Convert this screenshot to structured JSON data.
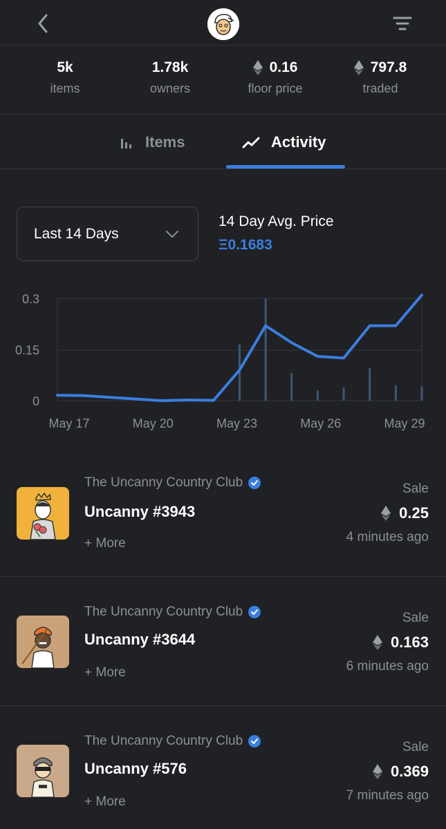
{
  "header": {
    "back_icon": "chevron-left-icon",
    "avatar_icon": "collection-avatar",
    "filter_icon": "filter-icon"
  },
  "stats": [
    {
      "value": "5k",
      "label": "items",
      "eth": false
    },
    {
      "value": "1.78k",
      "label": "owners",
      "eth": false
    },
    {
      "value": "0.16",
      "label": "floor price",
      "eth": true
    },
    {
      "value": "797.8",
      "label": "traded",
      "eth": true
    }
  ],
  "tabs": [
    {
      "label": "Items",
      "icon": "bar-chart-icon",
      "active": false
    },
    {
      "label": "Activity",
      "icon": "trend-line-icon",
      "active": true
    }
  ],
  "period": {
    "selected": "Last 14 Days"
  },
  "avg": {
    "label": "14 Day Avg. Price",
    "value": "Ξ0.1683"
  },
  "colors": {
    "accent": "#3b7ee0",
    "muted": "#8b8f96",
    "bg": "#202124"
  },
  "chart_data": {
    "type": "line",
    "x_labels": [
      "May 17",
      "May 20",
      "May 23",
      "May 26",
      "May 29"
    ],
    "y_ticks": [
      "0.3",
      "0.15",
      "0"
    ],
    "ylim": [
      0,
      0.3
    ],
    "line": [
      0.016,
      0.015,
      0.01,
      0.005,
      0,
      0.002,
      0.001,
      0.09,
      0.22,
      0.17,
      0.13,
      0.125,
      0.22,
      0.22,
      0.31
    ],
    "volume": [
      0,
      0,
      0,
      0,
      0,
      0,
      0,
      0.55,
      1.0,
      0.27,
      0.1,
      0.13,
      0.32,
      0.15,
      0.14
    ],
    "volume_ylim": [
      0,
      1
    ]
  },
  "activity": [
    {
      "collection": "The Uncanny Country Club",
      "name": "Uncanny #3943",
      "more": "+ More",
      "type": "Sale",
      "price": "0.25",
      "time": "4 minutes ago"
    },
    {
      "collection": "The Uncanny Country Club",
      "name": "Uncanny #3644",
      "more": "+ More",
      "type": "Sale",
      "price": "0.163",
      "time": "6 minutes ago"
    },
    {
      "collection": "The Uncanny Country Club",
      "name": "Uncanny #576",
      "more": "+ More",
      "type": "Sale",
      "price": "0.369",
      "time": "7 minutes ago"
    }
  ]
}
